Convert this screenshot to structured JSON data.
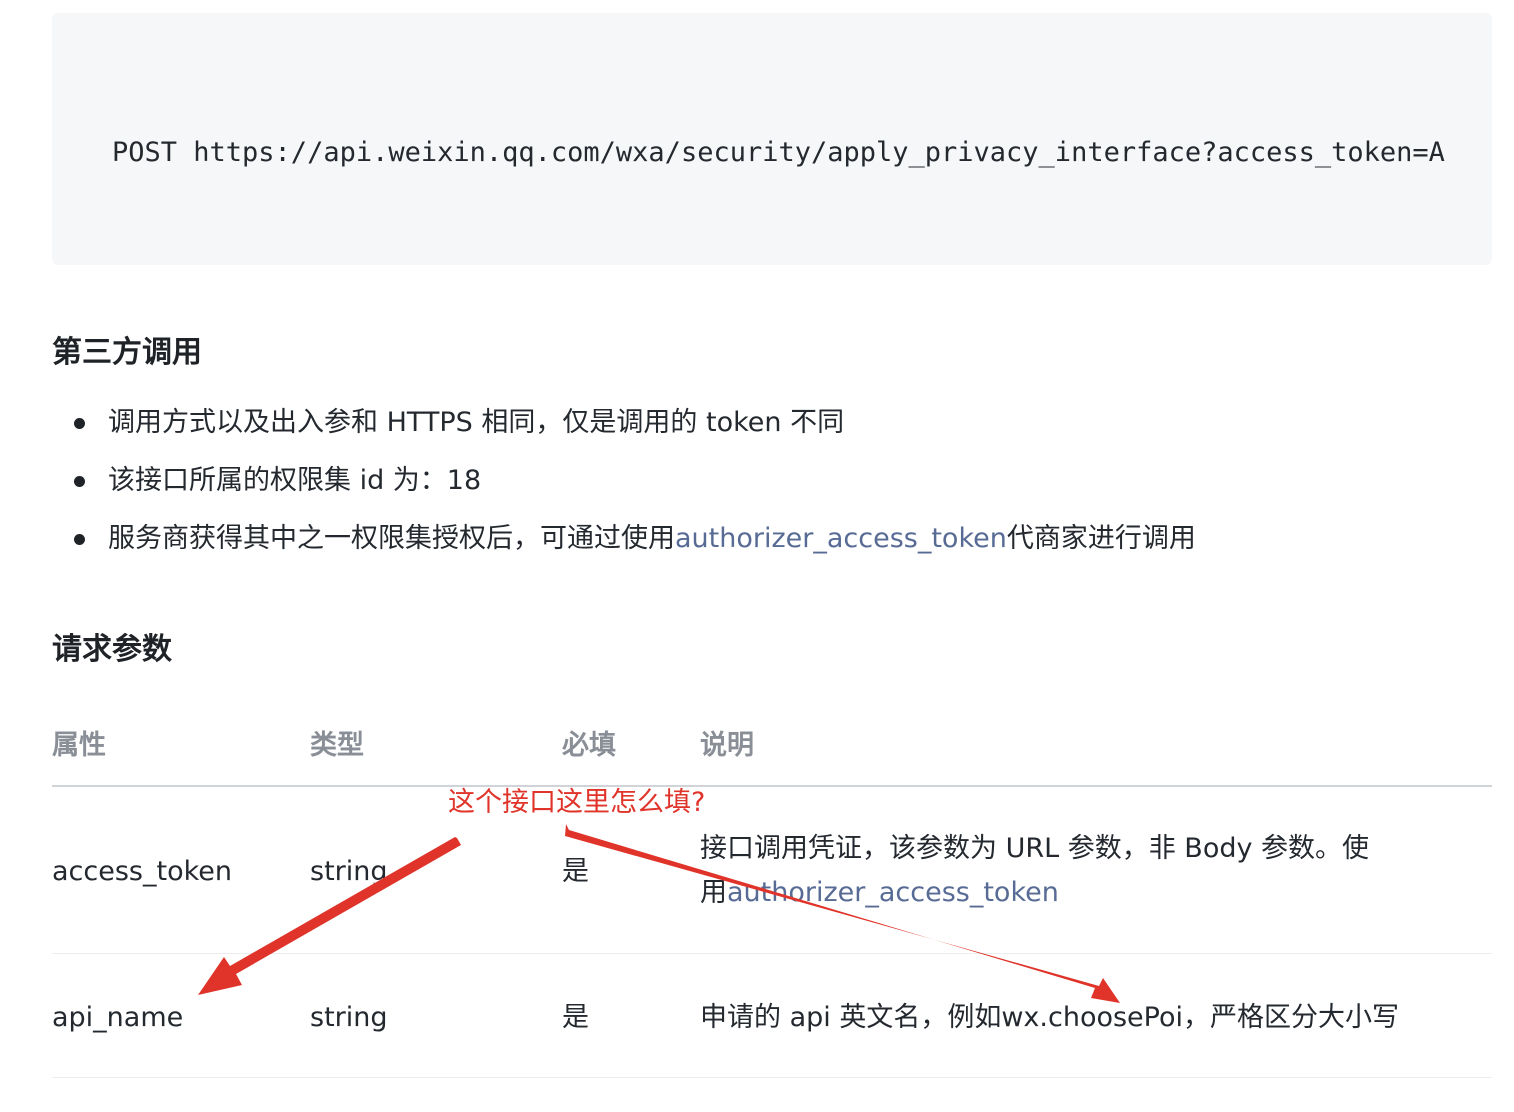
{
  "code": {
    "text": "POST https://api.weixin.qq.com/wxa/security/apply_privacy_interface?access_token=A"
  },
  "third_party": {
    "heading": "第三方调用",
    "bullets": [
      {
        "text": "调用方式以及出入参和 HTTPS 相同，仅是调用的 token 不同"
      },
      {
        "text": "该接口所属的权限集 id 为：18"
      },
      {
        "prefix": "服务商获得其中之一权限集授权后，可通过使用",
        "link": "authorizer_access_token",
        "suffix": "代商家进行调用"
      }
    ]
  },
  "params": {
    "heading": "请求参数",
    "columns": [
      "属性",
      "类型",
      "必填",
      "说明"
    ],
    "rows": [
      {
        "name": "access_token",
        "type": "string",
        "required": "是",
        "desc_line1": "接口调用凭证，该参数为 URL 参数，非 Body 参数。使",
        "desc_line2_prefix": "用",
        "desc_link": "authorizer_access_token"
      },
      {
        "name": "api_name",
        "type": "string",
        "required": "是",
        "desc": "申请的 api 英文名，例如wx.choosePoi，严格区分大小写"
      }
    ]
  },
  "annotation": {
    "text": "这个接口这里怎么填?",
    "color": "#e0342a"
  },
  "colors": {
    "link": "#576b95",
    "code_bg": "#f6f7f9",
    "header_text": "#8a8f97"
  }
}
